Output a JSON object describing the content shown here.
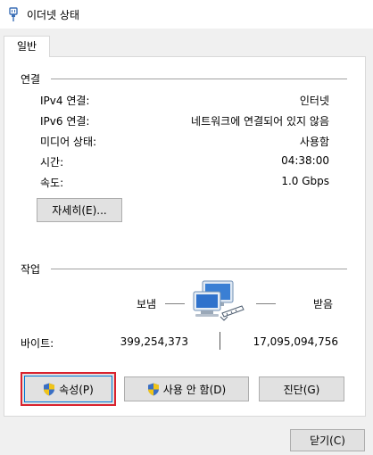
{
  "window": {
    "title": "이더넷 상태"
  },
  "tabs": [
    {
      "label": "일반"
    }
  ],
  "connection": {
    "heading": "연결",
    "rows": [
      {
        "label": "IPv4 연결:",
        "value": "인터넷"
      },
      {
        "label": "IPv6 연결:",
        "value": "네트워크에 연결되어 있지 않음"
      },
      {
        "label": "미디어 상태:",
        "value": "사용함"
      },
      {
        "label": "시간:",
        "value": "04:38:00"
      },
      {
        "label": "속도:",
        "value": "1.0 Gbps"
      }
    ],
    "details_button": "자세히(E)..."
  },
  "activity": {
    "heading": "작업",
    "sent_label": "보냄",
    "received_label": "받음",
    "bytes_label": "바이트:",
    "bytes_sent": "399,254,373",
    "bytes_received": "17,095,094,756"
  },
  "actions": {
    "properties_button": "속성(P)",
    "disable_button": "사용 안 함(D)",
    "diagnose_button": "진단(G)"
  },
  "footer": {
    "close_button": "닫기(C)"
  },
  "icons": {
    "title": "ethernet-plug-icon",
    "network": "network-computers-icon",
    "shield": "uac-shield-icon"
  },
  "colors": {
    "highlight": "#d9232f",
    "focus": "#0078d7"
  }
}
